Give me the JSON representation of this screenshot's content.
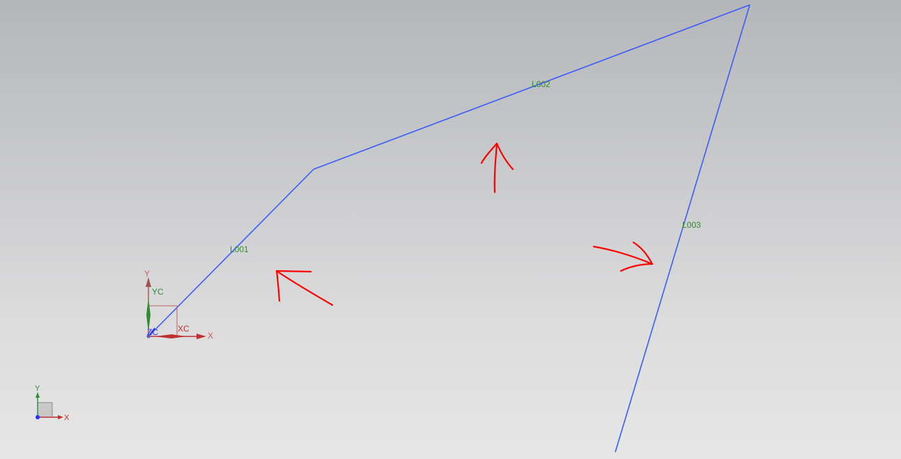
{
  "curves": [
    {
      "label": "L001"
    },
    {
      "label": "L002"
    },
    {
      "label": "L003"
    }
  ],
  "wcs": {
    "x_label": "X",
    "y_label": "Y",
    "xc_label": "XC",
    "yc_label": "YC",
    "zc_label": "ZC"
  },
  "triad": {
    "x_label": "X",
    "y_label": "Y"
  },
  "annotations": [
    {
      "type": "arrow",
      "color": "#ff0000",
      "name": "red-arrow-up-left"
    },
    {
      "type": "arrow",
      "color": "#ff0000",
      "name": "red-arrow-up"
    },
    {
      "type": "arrow",
      "color": "#ff0000",
      "name": "red-arrow-right"
    }
  ],
  "colors": {
    "curve": "#3a5cff",
    "curve_label": "#2e8b2e",
    "annotation": "#ff0000",
    "axis_x": "#c03030",
    "axis_y": "#2e8b2e",
    "axis_z": "#2a2aff"
  }
}
